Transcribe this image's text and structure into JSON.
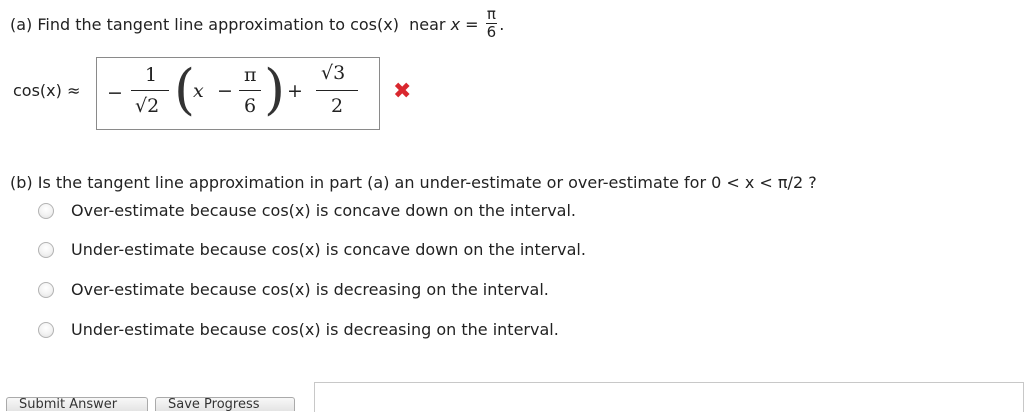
{
  "part_a": {
    "prefix": "(a) Find the tangent line approximation to ",
    "func": "cos(x)",
    "near": "near ",
    "var": "x",
    "eq": " = ",
    "pi": "π",
    "six": "6",
    "period": "."
  },
  "answer": {
    "lhs": "cos(x) ≈",
    "minus": "−",
    "one": "1",
    "sqrt2": "√2",
    "x": "x",
    "pi": "π",
    "six": "6",
    "plus": "+",
    "sqrt3": "√3",
    "two": "2",
    "status_icon": "x-mark-icon",
    "status_color": "#d9272e"
  },
  "part_b": {
    "question": "(b) Is the tangent line approximation in part (a) an under-estimate or over-estimate for  0 < x < π/2 ?",
    "options": [
      "Over-estimate because cos(x) is concave down on the interval.",
      "Under-estimate because cos(x) is concave down on the interval.",
      "Over-estimate because cos(x) is decreasing on the interval.",
      "Under-estimate because cos(x) is decreasing on the interval."
    ]
  },
  "buttons": {
    "submit": "Submit Answer",
    "save": "Save Progress"
  }
}
